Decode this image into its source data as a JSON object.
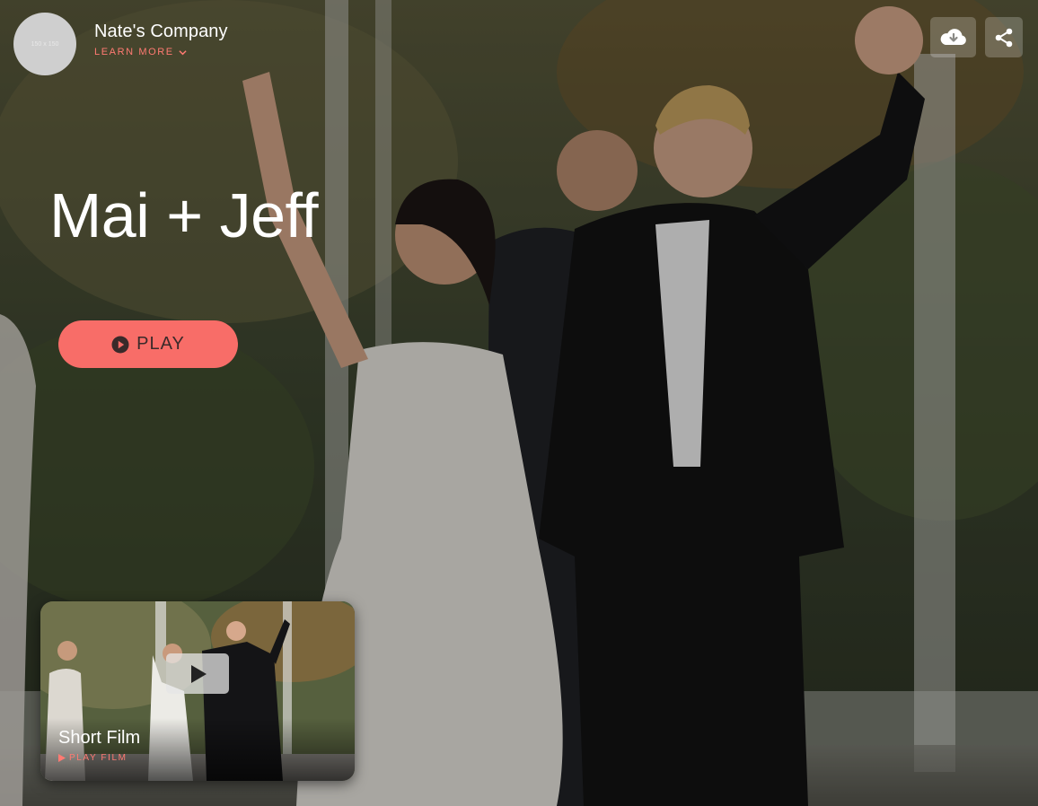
{
  "header": {
    "logo_placeholder": "150 x 150",
    "company_name": "Nate's Company",
    "learn_more_label": "LEARN MORE",
    "download_icon": "cloud-download-icon",
    "share_icon": "share-icon"
  },
  "hero": {
    "title": "Mai + Jeff",
    "play_label": "PLAY",
    "play_icon": "play-circle-icon"
  },
  "film_card": {
    "title": "Short Film",
    "subtitle": "PLAY FILM",
    "play_icon": "play-icon"
  },
  "colors": {
    "accent": "#f86d68",
    "accent_text": "#ff7a72",
    "text": "#ffffff"
  }
}
